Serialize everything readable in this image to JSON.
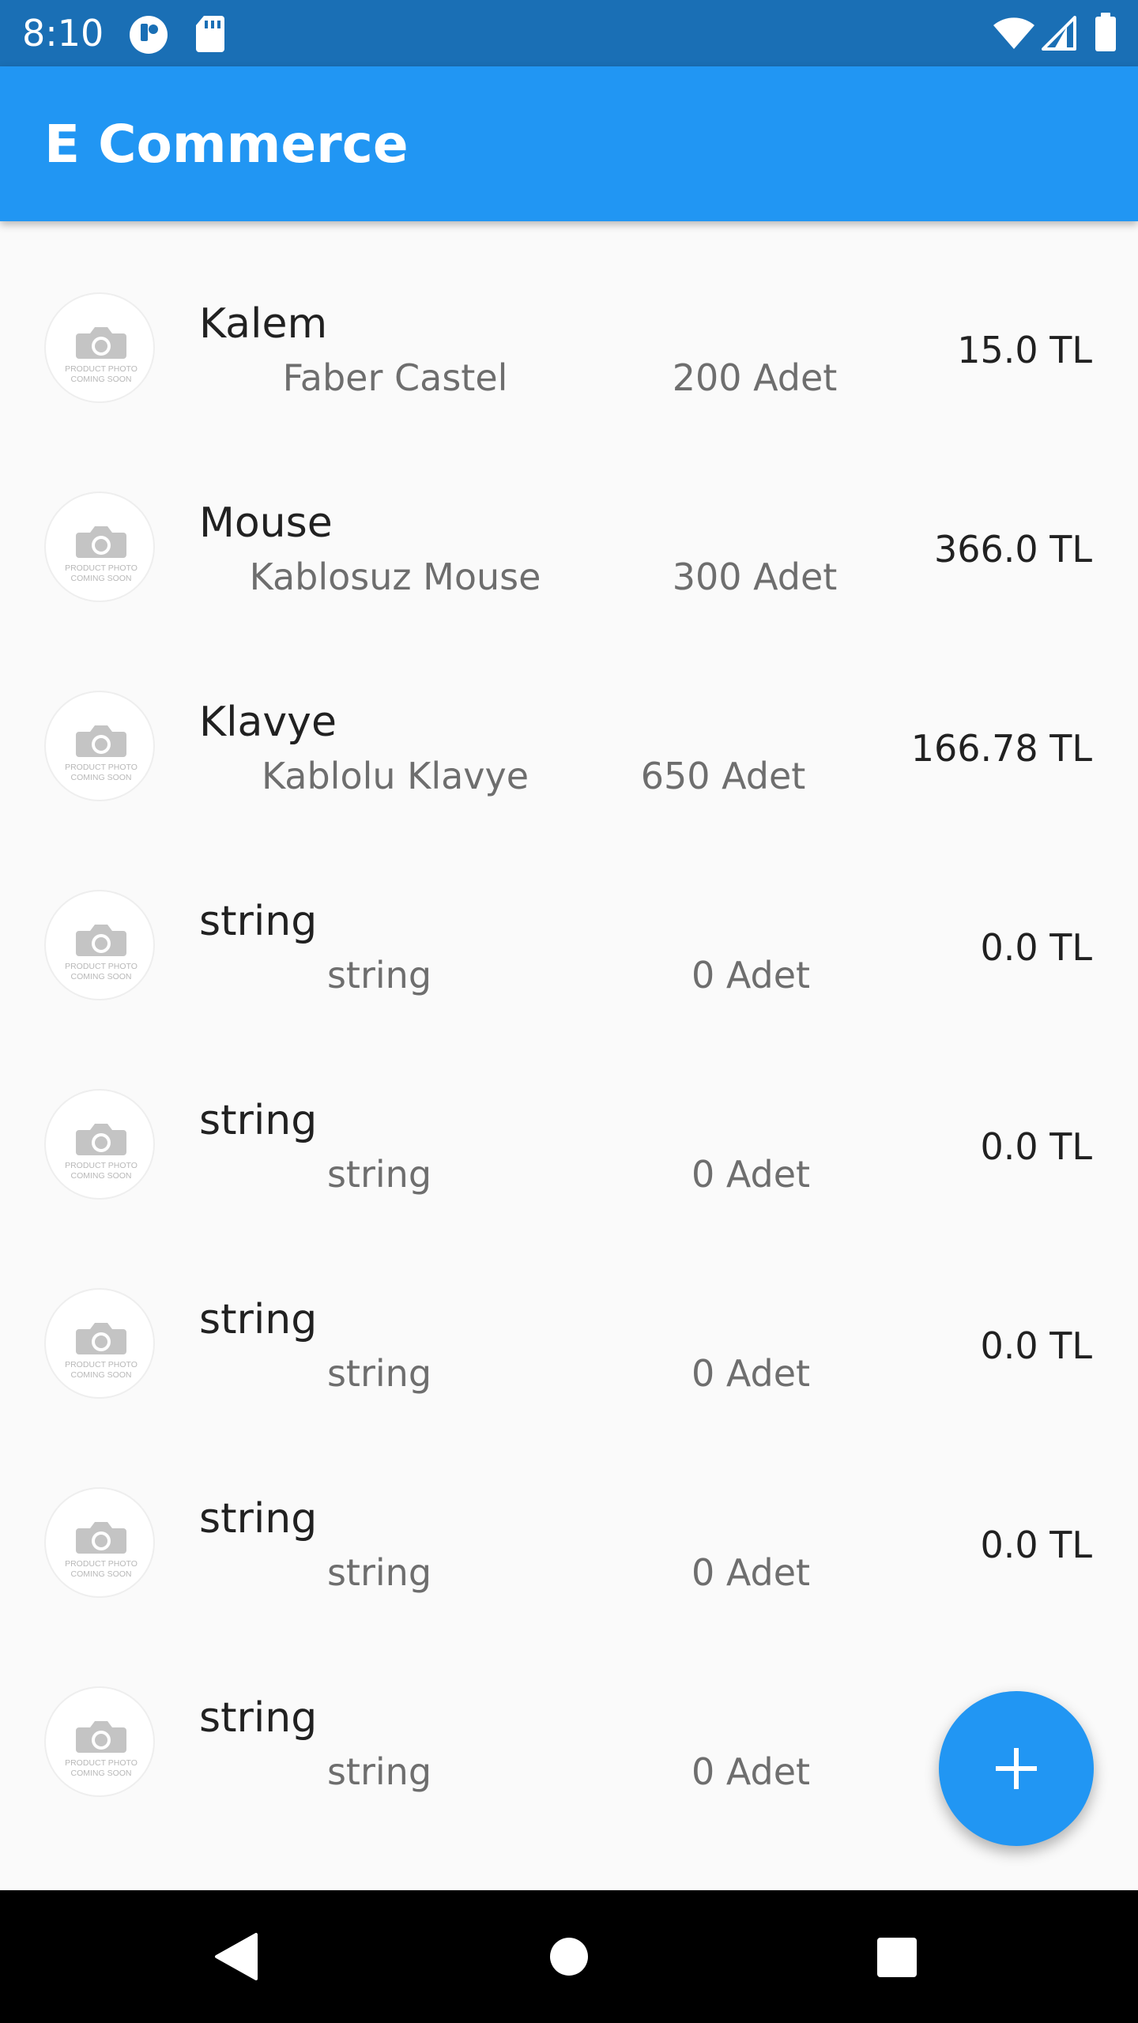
{
  "status_bar": {
    "time": "8:10",
    "left_icons": [
      "notification-app-icon",
      "sd-card-icon"
    ],
    "right_icons": [
      "wifi-icon",
      "cellular-signal-icon",
      "battery-icon"
    ]
  },
  "app_bar": {
    "title": "E Commerce",
    "color": "#2196f3"
  },
  "products": {
    "thumbnail_icon": "camera-icon",
    "thumbnail_text": [
      "PRODUCT PHOTO",
      "COMING SOON"
    ],
    "items": [
      {
        "name": "Kalem",
        "brand": "Faber Castel",
        "quantity": "200 Adet",
        "price": "15.0 TL"
      },
      {
        "name": "Mouse",
        "brand": "Kablosuz Mouse",
        "quantity": "300 Adet",
        "price": "366.0 TL"
      },
      {
        "name": "Klavye",
        "brand": "Kablolu Klavye",
        "quantity": "650 Adet",
        "price": "166.78 TL"
      },
      {
        "name": "string",
        "brand": "string",
        "quantity": "0 Adet",
        "price": "0.0 TL"
      },
      {
        "name": "string",
        "brand": "string",
        "quantity": "0 Adet",
        "price": "0.0 TL"
      },
      {
        "name": "string",
        "brand": "string",
        "quantity": "0 Adet",
        "price": "0.0 TL"
      },
      {
        "name": "string",
        "brand": "string",
        "quantity": "0 Adet",
        "price": "0.0 TL"
      },
      {
        "name": "string",
        "brand": "string",
        "quantity": "0 Adet",
        "price": ""
      }
    ]
  },
  "fab": {
    "icon": "plus-icon",
    "color": "#2196f3"
  },
  "nav_bar": {
    "icons": [
      "back-icon",
      "home-icon",
      "recents-icon"
    ]
  }
}
